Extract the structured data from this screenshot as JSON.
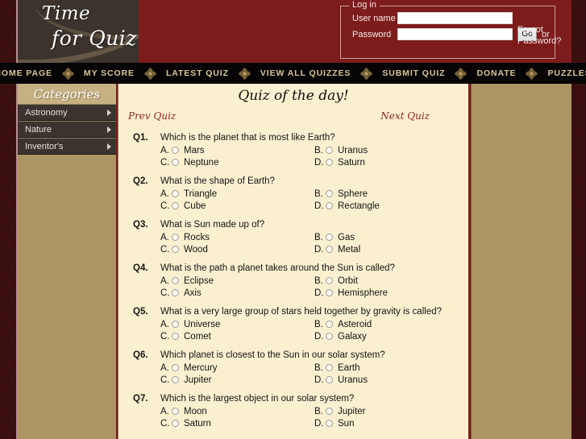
{
  "site": {
    "logo_line1": "Time",
    "logo_line2": "for Quiz"
  },
  "login": {
    "legend": "Log in",
    "username_label": "User name",
    "username_value": "",
    "username_placeholder": "",
    "password_label": "Password",
    "password_value": "",
    "password_placeholder": "",
    "forgot_label": "Forgot Password?",
    "go_label": "Go",
    "or_label": "or"
  },
  "nav": {
    "items": [
      {
        "label": "HOME PAGE"
      },
      {
        "label": "MY SCORE"
      },
      {
        "label": "LATEST QUIZ"
      },
      {
        "label": "VIEW ALL QUIZZES"
      },
      {
        "label": "SUBMIT QUIZ"
      },
      {
        "label": "DONATE"
      },
      {
        "label": "PUZZLES"
      }
    ]
  },
  "sidebar": {
    "header": "Categories",
    "items": [
      {
        "label": "Astronomy"
      },
      {
        "label": "Nature"
      },
      {
        "label": "Inventor's"
      }
    ]
  },
  "main": {
    "title": "Quiz of the day!",
    "prev_label": "Prev Quiz",
    "next_label": "Next Quiz",
    "questions": [
      {
        "number": "Q1.",
        "text": "Which is the planet that is most like Earth?",
        "options": [
          {
            "letter": "A.",
            "label": "Mars"
          },
          {
            "letter": "B.",
            "label": "Uranus"
          },
          {
            "letter": "C.",
            "label": "Neptune"
          },
          {
            "letter": "D.",
            "label": "Saturn"
          }
        ]
      },
      {
        "number": "Q2.",
        "text": "What is the shape of Earth?",
        "options": [
          {
            "letter": "A.",
            "label": "Triangle"
          },
          {
            "letter": "B.",
            "label": "Sphere"
          },
          {
            "letter": "C.",
            "label": "Cube"
          },
          {
            "letter": "D.",
            "label": "Rectangle"
          }
        ]
      },
      {
        "number": "Q3.",
        "text": "What is Sun made up of?",
        "options": [
          {
            "letter": "A.",
            "label": "Rocks"
          },
          {
            "letter": "B.",
            "label": "Gas"
          },
          {
            "letter": "C.",
            "label": "Wood"
          },
          {
            "letter": "D.",
            "label": "Metal"
          }
        ]
      },
      {
        "number": "Q4.",
        "text": "What is the path a planet takes around the Sun is called?",
        "options": [
          {
            "letter": "A.",
            "label": "Eclipse"
          },
          {
            "letter": "B.",
            "label": "Orbit"
          },
          {
            "letter": "C.",
            "label": "Axis"
          },
          {
            "letter": "D.",
            "label": "Hemisphere"
          }
        ]
      },
      {
        "number": "Q5.",
        "text": "What is a very large group of stars held together by gravity is called?",
        "options": [
          {
            "letter": "A.",
            "label": "Universe"
          },
          {
            "letter": "B.",
            "label": "Asteroid"
          },
          {
            "letter": "C.",
            "label": "Comet"
          },
          {
            "letter": "D.",
            "label": "Galaxy"
          }
        ]
      },
      {
        "number": "Q6.",
        "text": "Which planet is closest to the Sun in our solar system?",
        "options": [
          {
            "letter": "A.",
            "label": "Mercury"
          },
          {
            "letter": "B.",
            "label": "Earth"
          },
          {
            "letter": "C.",
            "label": "Jupiter"
          },
          {
            "letter": "D.",
            "label": "Uranus"
          }
        ]
      },
      {
        "number": "Q7.",
        "text": "Which is the largest object in our solar system?",
        "options": [
          {
            "letter": "A.",
            "label": "Moon"
          },
          {
            "letter": "B.",
            "label": "Jupiter"
          },
          {
            "letter": "C.",
            "label": "Saturn"
          },
          {
            "letter": "D.",
            "label": "Sun"
          }
        ]
      }
    ]
  },
  "colors": {
    "header_red": "#7d1c1c",
    "nav_black": "#070406",
    "panel_tan": "#ad9663",
    "content_cream": "#faf0d0",
    "sidebar_item": "#3d342f",
    "nav_text_gold": "#d9c89a",
    "link_red": "#8a1f1f"
  }
}
